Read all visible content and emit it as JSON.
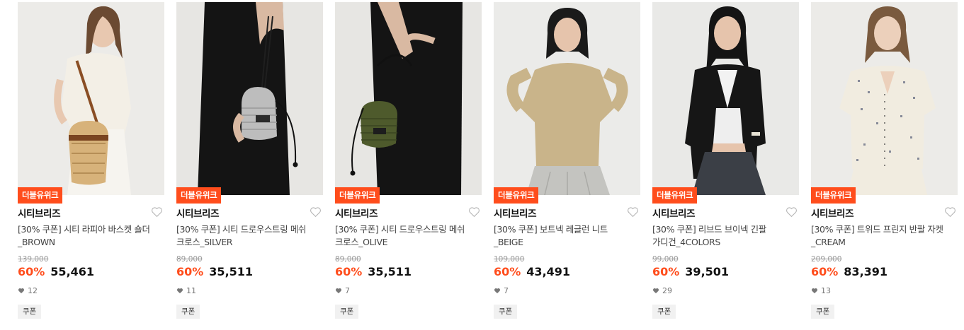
{
  "products": [
    {
      "badge": "더블유위크",
      "brand": "시티브리즈",
      "name_line1": "[30% 쿠폰] 시티 라피아 바스켓 숄더",
      "name_line2": "_BROWN",
      "original_price": "139,000",
      "discount": "60%",
      "price": "55,461",
      "likes": "12",
      "coupon": "쿠폰",
      "image_desc": "model-white-shirt-rattan-basket-bag"
    },
    {
      "badge": "더블유위크",
      "brand": "시티브리즈",
      "name_line1": "[30% 쿠폰] 시티 드로우스트링 메쉬",
      "name_line2": "크로스_SILVER",
      "original_price": "89,000",
      "discount": "60%",
      "price": "35,511",
      "likes": "11",
      "coupon": "쿠폰",
      "image_desc": "black-dress-silver-mesh-bag"
    },
    {
      "badge": "더블유위크",
      "brand": "시티브리즈",
      "name_line1": "[30% 쿠폰] 시티 드로우스트링 메쉬",
      "name_line2": "크로스_OLIVE",
      "original_price": "89,000",
      "discount": "60%",
      "price": "35,511",
      "likes": "7",
      "coupon": "쿠폰",
      "image_desc": "black-dress-olive-mesh-bag"
    },
    {
      "badge": "더블유위크",
      "brand": "시티브리즈",
      "name_line1": "[30% 쿠폰] 보트넥 레글런 니트",
      "name_line2": "_BEIGE",
      "original_price": "109,000",
      "discount": "60%",
      "price": "43,491",
      "likes": "7",
      "coupon": "쿠폰",
      "image_desc": "model-beige-knit"
    },
    {
      "badge": "더블유위크",
      "brand": "시티브리즈",
      "name_line1": "[30% 쿠폰] 리브드 브이넥 긴팔",
      "name_line2": "가디건_4COLORS",
      "original_price": "99,000",
      "discount": "60%",
      "price": "39,501",
      "likes": "29",
      "coupon": "쿠폰",
      "image_desc": "model-black-cardigan"
    },
    {
      "badge": "더블유위크",
      "brand": "시티브리즈",
      "name_line1": "[30% 쿠폰] 트위드 프린지 반팔 자켓",
      "name_line2": "_CREAM",
      "original_price": "209,000",
      "discount": "60%",
      "price": "83,391",
      "likes": "13",
      "coupon": "쿠폰",
      "image_desc": "model-cream-tweed-jacket"
    }
  ],
  "colors": {
    "accent": "#ff4d1c",
    "text": "#111111",
    "muted": "#9a9a9a",
    "coupon_bg": "#f1f1f1"
  },
  "icons": [
    "heart-outline-icon",
    "heart-filled-icon"
  ]
}
